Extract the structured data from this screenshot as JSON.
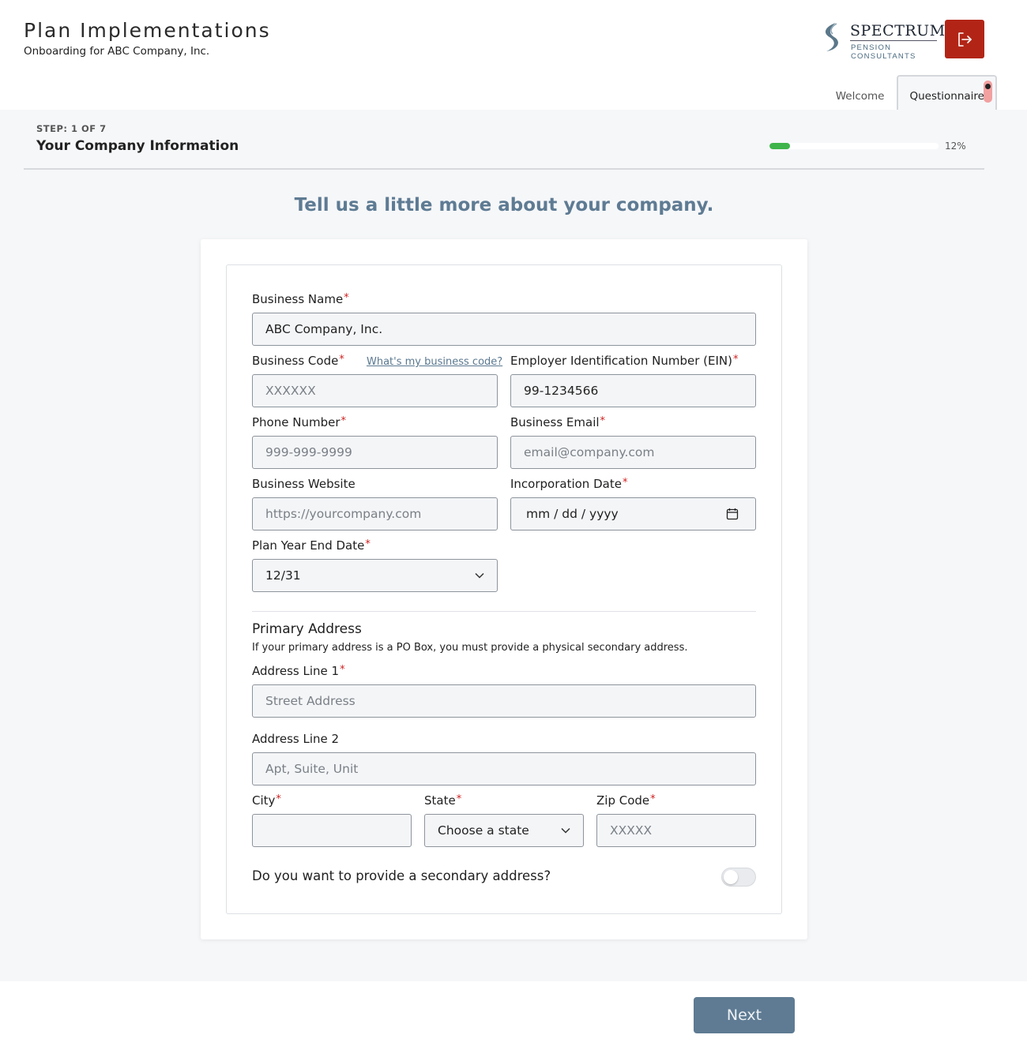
{
  "header": {
    "title": "Plan Implementations",
    "subtitle": "Onboarding for ABC Company, Inc.",
    "logo": {
      "name": "SPECTRUM",
      "tagline": "PENSION CONSULTANTS"
    },
    "logout_icon": "logout-icon",
    "tabs": [
      {
        "label": "Welcome",
        "active": false
      },
      {
        "label": "Questionnaire",
        "active": true
      }
    ]
  },
  "step": {
    "label": "STEP: 1 OF 7",
    "title": "Your Company Information",
    "progress_percent": 12,
    "progress_text": "12%"
  },
  "lead": "Tell us a little more about your company.",
  "form": {
    "business_name": {
      "label": "Business Name",
      "required": "*",
      "value": "ABC Company, Inc."
    },
    "business_code": {
      "label": "Business Code",
      "required": "*",
      "placeholder": "XXXXXX",
      "help_link": "What's my business code?"
    },
    "ein": {
      "label": "Employer Identification Number (EIN)",
      "required": "*",
      "value": "99-1234566"
    },
    "phone": {
      "label": "Phone Number",
      "required": "*",
      "placeholder": "999-999-9999"
    },
    "email": {
      "label": "Business Email",
      "required": "*",
      "placeholder": "email@company.com"
    },
    "website": {
      "label": "Business Website",
      "placeholder": "https://yourcompany.com"
    },
    "incorporation_date": {
      "label": "Incorporation Date",
      "required": "*",
      "placeholder": "mm / dd / yyyy",
      "icon": "calendar-icon"
    },
    "plan_year_end": {
      "label": "Plan Year End Date",
      "required": "*",
      "value": "12/31"
    },
    "primary_address": {
      "title": "Primary Address",
      "note": "If your primary address is a PO Box, you must provide a physical secondary address.",
      "line1": {
        "label": "Address Line 1",
        "required": "*",
        "placeholder": "Street Address"
      },
      "line2": {
        "label": "Address Line 2",
        "placeholder": "Apt, Suite, Unit"
      },
      "city": {
        "label": "City",
        "required": "*",
        "value": ""
      },
      "state": {
        "label": "State",
        "required": "*",
        "value": "Choose a state"
      },
      "zip": {
        "label": "Zip Code",
        "required": "*",
        "placeholder": "XXXXX"
      }
    },
    "secondary_question": "Do you want to provide a secondary address?",
    "secondary_toggle_on": false
  },
  "footer": {
    "next_label": "Next"
  },
  "colors": {
    "accent": "#5e7b93",
    "logout_bg": "#b22516",
    "progress": "#3fb44a",
    "required": "#d02020"
  }
}
